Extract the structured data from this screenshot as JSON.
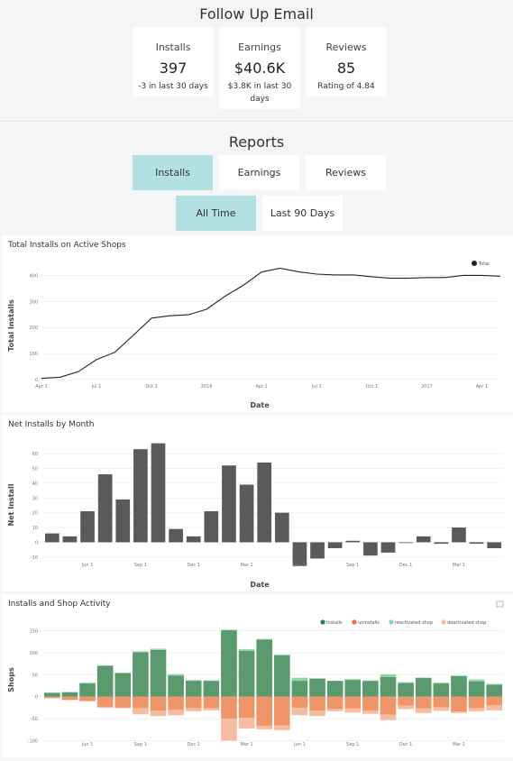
{
  "app": {
    "title": "Follow Up Email"
  },
  "stats": [
    {
      "label": "Installs",
      "value": "397",
      "sub": "-3 in last 30 days"
    },
    {
      "label": "Earnings",
      "value": "$40.6K",
      "sub": "$3.8K in last 30 days"
    },
    {
      "label": "Reviews",
      "value": "85",
      "sub": "Rating of 4.84"
    }
  ],
  "reports": {
    "title": "Reports",
    "tabs": [
      {
        "label": "Installs",
        "active": true
      },
      {
        "label": "Earnings",
        "active": false
      },
      {
        "label": "Reviews",
        "active": false
      }
    ],
    "ranges": [
      {
        "label": "All Time",
        "active": true
      },
      {
        "label": "Last 90 Days",
        "active": false
      }
    ]
  },
  "colors": {
    "accent": "#b2e0e3",
    "line": "#222222",
    "bar": "#5a5a5a",
    "installs": "#5a9a6e",
    "uninstalls": "#f0956a",
    "reactivated": "#8dd4a6",
    "deactivated": "#f6bc9f"
  },
  "chart_data": [
    {
      "type": "line",
      "title": "Total Installs on Active Shops",
      "xlabel": "Date",
      "ylabel": "Total Installs",
      "ylim": [
        0,
        450
      ],
      "yticks": [
        0,
        100,
        200,
        300,
        400
      ],
      "xticks": [
        "Apr 1",
        "Jul 1",
        "Oct 1",
        "2016",
        "Apr 1",
        "Jul 1",
        "Oct 1",
        "2017",
        "Apr 1"
      ],
      "grid": true,
      "legend": {
        "position": "top-right",
        "entries": [
          "Total"
        ]
      },
      "x": [
        "2015-04",
        "2015-05",
        "2015-06",
        "2015-07",
        "2015-08",
        "2015-09",
        "2015-10",
        "2015-11",
        "2015-12",
        "2016-01",
        "2016-02",
        "2016-03",
        "2016-04",
        "2016-05",
        "2016-06",
        "2016-07",
        "2016-08",
        "2016-09",
        "2016-10",
        "2016-11",
        "2016-12",
        "2017-01",
        "2017-02",
        "2017-03",
        "2017-04",
        "2017-05"
      ],
      "series": [
        {
          "name": "Total",
          "values": [
            5,
            9,
            30,
            77,
            105,
            170,
            236,
            245,
            249,
            270,
            320,
            362,
            413,
            428,
            414,
            405,
            402,
            402,
            395,
            389,
            389,
            392,
            392,
            400,
            400,
            397
          ]
        }
      ]
    },
    {
      "type": "bar",
      "title": "Net Installs by Month",
      "xlabel": "Date",
      "ylabel": "Net Install",
      "ylim": [
        -15,
        68
      ],
      "yticks": [
        -10,
        0,
        10,
        20,
        30,
        40,
        50,
        60
      ],
      "xticks": [
        "Jun 1",
        "Sep 1",
        "Dec 1",
        "Mar 1",
        "Jun 1",
        "Sep 1",
        "Dec 1",
        "Mar 1"
      ],
      "grid": true,
      "categories": [
        "2015-04",
        "2015-05",
        "2015-06",
        "2015-07",
        "2015-08",
        "2015-09",
        "2015-10",
        "2015-11",
        "2015-12",
        "2016-01",
        "2016-02",
        "2016-03",
        "2016-04",
        "2016-05",
        "2016-06",
        "2016-07",
        "2016-08",
        "2016-09",
        "2016-10",
        "2016-11",
        "2016-12",
        "2017-01",
        "2017-02",
        "2017-03",
        "2017-04",
        "2017-05"
      ],
      "values": [
        6,
        4,
        21,
        46,
        29,
        63,
        67,
        9,
        4,
        21,
        52,
        39,
        54,
        20,
        -16,
        -11,
        -4,
        1,
        -9,
        -7,
        0,
        4,
        -1,
        10,
        -1,
        -4
      ]
    },
    {
      "type": "bar",
      "stacked": true,
      "title": "Installs and Shop Activity",
      "xlabel": "",
      "ylabel": "Shops",
      "ylim": [
        -105,
        155
      ],
      "yticks": [
        -100,
        -50,
        0,
        50,
        100,
        150
      ],
      "xticks": [
        "Jun 1",
        "Sep 1",
        "Dec 1",
        "Mar 1",
        "Jun 1",
        "Sep 1",
        "Dec 1",
        "Mar 1"
      ],
      "grid": true,
      "legend": {
        "position": "top-right",
        "entries": [
          "installs",
          "uninstalls",
          "reactivated shop",
          "deactivated shop"
        ]
      },
      "categories": [
        "2015-04",
        "2015-05",
        "2015-06",
        "2015-07",
        "2015-08",
        "2015-09",
        "2015-10",
        "2015-11",
        "2015-12",
        "2016-01",
        "2016-02",
        "2016-03",
        "2016-04",
        "2016-05",
        "2016-06",
        "2016-07",
        "2016-08",
        "2016-09",
        "2016-10",
        "2016-11",
        "2016-12",
        "2017-01",
        "2017-02",
        "2017-03",
        "2017-04",
        "2017-05"
      ],
      "series": [
        {
          "name": "installs",
          "values": [
            9,
            10,
            31,
            70,
            54,
            101,
            106,
            48,
            36,
            36,
            151,
            104,
            130,
            94,
            36,
            41,
            36,
            38,
            36,
            45,
            31,
            43,
            30,
            47,
            35,
            27
          ]
        },
        {
          "name": "uninstalls",
          "values": [
            -3,
            -7,
            -10,
            -23,
            -25,
            -26,
            -32,
            -30,
            -26,
            -26,
            -50,
            -48,
            -66,
            -65,
            -25,
            -32,
            -28,
            -27,
            -32,
            -41,
            -20,
            -27,
            -24,
            -34,
            -26,
            -19
          ]
        },
        {
          "name": "reactivated shop",
          "values": [
            0,
            1,
            0,
            1,
            0,
            2,
            3,
            3,
            2,
            1,
            1,
            4,
            1,
            2,
            7,
            1,
            0,
            2,
            1,
            6,
            2,
            0,
            2,
            1,
            4,
            2
          ]
        },
        {
          "name": "deactivated shop",
          "values": [
            -1,
            -1,
            0,
            -2,
            -1,
            -14,
            -12,
            -12,
            -7,
            -5,
            -50,
            -24,
            -8,
            -11,
            -17,
            -12,
            -5,
            -9,
            -7,
            -12,
            -8,
            -10,
            -8,
            -3,
            -7,
            -12
          ]
        }
      ]
    }
  ]
}
